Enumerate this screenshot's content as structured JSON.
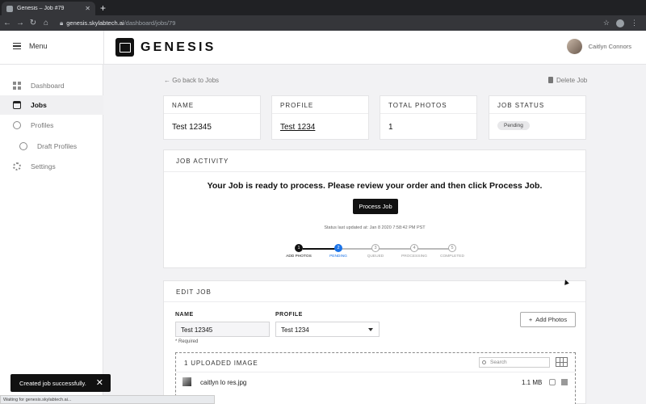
{
  "browser": {
    "tab_title": "Genesis – Job #79",
    "url_host": "genesis.skylabtech.ai",
    "url_path": "/dashboard/jobs/79",
    "status_text": "Waiting for genesis.skylabtech.ai..."
  },
  "header": {
    "menu_label": "Menu",
    "brand": "GENESIS",
    "user_name": "Caitlyn Connors"
  },
  "sidebar": {
    "items": [
      {
        "label": "Dashboard",
        "icon": "dashboard-icon"
      },
      {
        "label": "Jobs",
        "icon": "jobs-icon"
      },
      {
        "label": "Profiles",
        "icon": "globe-icon"
      },
      {
        "label": "Draft Profiles",
        "icon": "globe-icon"
      },
      {
        "label": "Settings",
        "icon": "gear-icon"
      }
    ]
  },
  "nav": {
    "back_label": "Go back to Jobs",
    "delete_label": "Delete Job"
  },
  "summary": {
    "name_title": "NAME",
    "name_value": "Test 12345",
    "profile_title": "PROFILE",
    "profile_value": "Test 1234",
    "photos_title": "TOTAL PHOTOS",
    "photos_value": "1",
    "status_title": "JOB STATUS",
    "status_value": "Pending"
  },
  "activity": {
    "title": "JOB ACTIVITY",
    "message": "Your Job is ready to process. Please review your order and then click Process Job.",
    "process_button": "Process Job",
    "status_updated": "Status last updated at: Jan 8 2020 7:58:42 PM PST",
    "steps": [
      {
        "num": "1",
        "label": "ADD PHOTOS",
        "state": "done"
      },
      {
        "num": "2",
        "label": "PENDING",
        "state": "current"
      },
      {
        "num": "3",
        "label": "QUEUED",
        "state": "todo"
      },
      {
        "num": "4",
        "label": "PROCESSING",
        "state": "todo"
      },
      {
        "num": "5",
        "label": "COMPLETED",
        "state": "todo"
      }
    ]
  },
  "edit": {
    "title": "EDIT JOB",
    "name_label": "NAME",
    "name_value": "Test 12345",
    "profile_label": "PROFILE",
    "profile_value": "Test 1234",
    "required_note": "* Required",
    "add_photos": "Add Photos",
    "uploaded_header": "1 UPLOADED IMAGE",
    "search_placeholder": "Search",
    "files": [
      {
        "name": "caitlyn lo res.jpg",
        "size": "1.1 MB"
      }
    ]
  },
  "toast": {
    "message": "Created job successfully."
  },
  "colors": {
    "accent": "#1a73e8",
    "primary": "#111111",
    "page_bg": "#f2f2f4"
  }
}
